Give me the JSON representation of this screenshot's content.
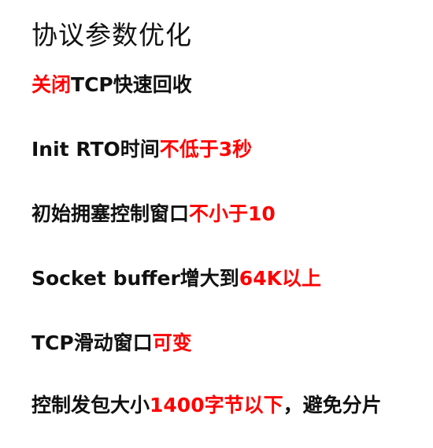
{
  "title": "协议参数优化",
  "lines": [
    {
      "segments": [
        {
          "text": "关闭",
          "color": "red"
        },
        {
          "text": "TCP快速回收",
          "color": "black"
        }
      ]
    },
    {
      "segments": [
        {
          "text": "Init RTO时间",
          "color": "black"
        },
        {
          "text": "不低于3秒",
          "color": "red"
        }
      ]
    },
    {
      "segments": [
        {
          "text": "初始拥塞控制窗口",
          "color": "black"
        },
        {
          "text": "不小于10",
          "color": "red"
        }
      ]
    },
    {
      "segments": [
        {
          "text": "Socket buffer增大到",
          "color": "black"
        },
        {
          "text": "64K以上",
          "color": "red"
        }
      ]
    },
    {
      "segments": [
        {
          "text": "TCP滑动窗口",
          "color": "black"
        },
        {
          "text": "可变",
          "color": "red"
        }
      ]
    },
    {
      "segments": [
        {
          "text": "控制发包大小",
          "color": "black"
        },
        {
          "text": "1400字节以下",
          "color": "red"
        },
        {
          "text": "，避免分片",
          "color": "black"
        }
      ]
    }
  ],
  "colors": {
    "red": "#ff0000",
    "black": "#111111"
  }
}
